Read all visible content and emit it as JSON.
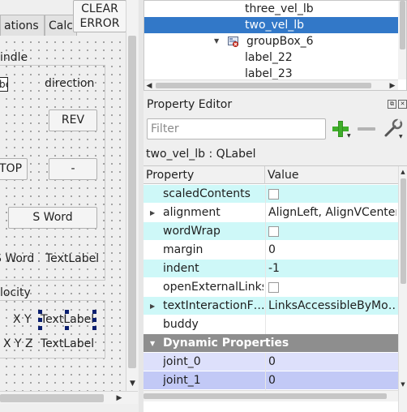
{
  "left_panel": {
    "tabs": [
      "ations",
      "Calc"
    ],
    "clear_button": [
      "CLEAR",
      "ERROR"
    ],
    "spindle_label": "indle",
    "direction_label": "direction",
    "small_field_text": "be",
    "rev_button": "REV",
    "stop_button": "TOP",
    "minus_button": "-",
    "s_word_button": "S Word",
    "s_word_label": "S Word",
    "text_label_1": "TextLabel",
    "velocity_label": "locity",
    "xy_label": "X Y",
    "xy_value": "TextLabel",
    "xyz_label": "X Y Z",
    "xyz_value": "TextLabel"
  },
  "object_tree": {
    "rows": [
      {
        "label": "three_vel_lb",
        "selected": false,
        "has_arrow": false,
        "has_icon": false
      },
      {
        "label": "two_vel_lb",
        "selected": true,
        "has_arrow": false,
        "has_icon": false
      },
      {
        "label": "groupBox_6",
        "selected": false,
        "has_arrow": true,
        "has_icon": true
      },
      {
        "label": "label_22",
        "selected": false,
        "has_arrow": false,
        "has_icon": false
      },
      {
        "label": "label_23",
        "selected": false,
        "has_arrow": false,
        "has_icon": false
      }
    ]
  },
  "property_editor": {
    "title": "Property Editor",
    "filter_placeholder": "Filter",
    "object_label": "two_vel_lb : QLabel",
    "headers": {
      "property": "Property",
      "value": "Value"
    },
    "rows": [
      {
        "name": "scaledContents",
        "value": "",
        "kind": "checkbox",
        "bg": "cyan",
        "expand": false
      },
      {
        "name": "alignment",
        "value": "AlignLeft, AlignVCenter",
        "kind": "text",
        "bg": "white",
        "expand": true
      },
      {
        "name": "wordWrap",
        "value": "",
        "kind": "checkbox",
        "bg": "cyan",
        "expand": false
      },
      {
        "name": "margin",
        "value": "0",
        "kind": "text",
        "bg": "white",
        "expand": false
      },
      {
        "name": "indent",
        "value": "-1",
        "kind": "text",
        "bg": "cyan",
        "expand": false
      },
      {
        "name": "openExternalLinks",
        "value": "",
        "kind": "checkbox",
        "bg": "white",
        "expand": false
      },
      {
        "name": "textInteractionF…",
        "value": "LinksAccessibleByMo…",
        "kind": "text",
        "bg": "cyan",
        "expand": true
      },
      {
        "name": "buddy",
        "value": "",
        "kind": "text",
        "bg": "white",
        "expand": false
      }
    ],
    "dynamic_group": "Dynamic Properties",
    "dynamic_rows": [
      {
        "name": "joint_0",
        "value": "0",
        "bg": "blue1"
      },
      {
        "name": "joint_1",
        "value": "0",
        "bg": "blue2"
      }
    ]
  },
  "colors": {
    "selection": "#3278c8",
    "cyan_row": "#cef8f8",
    "group_row": "#8e8e8e",
    "add_icon": "#3fae2a"
  }
}
